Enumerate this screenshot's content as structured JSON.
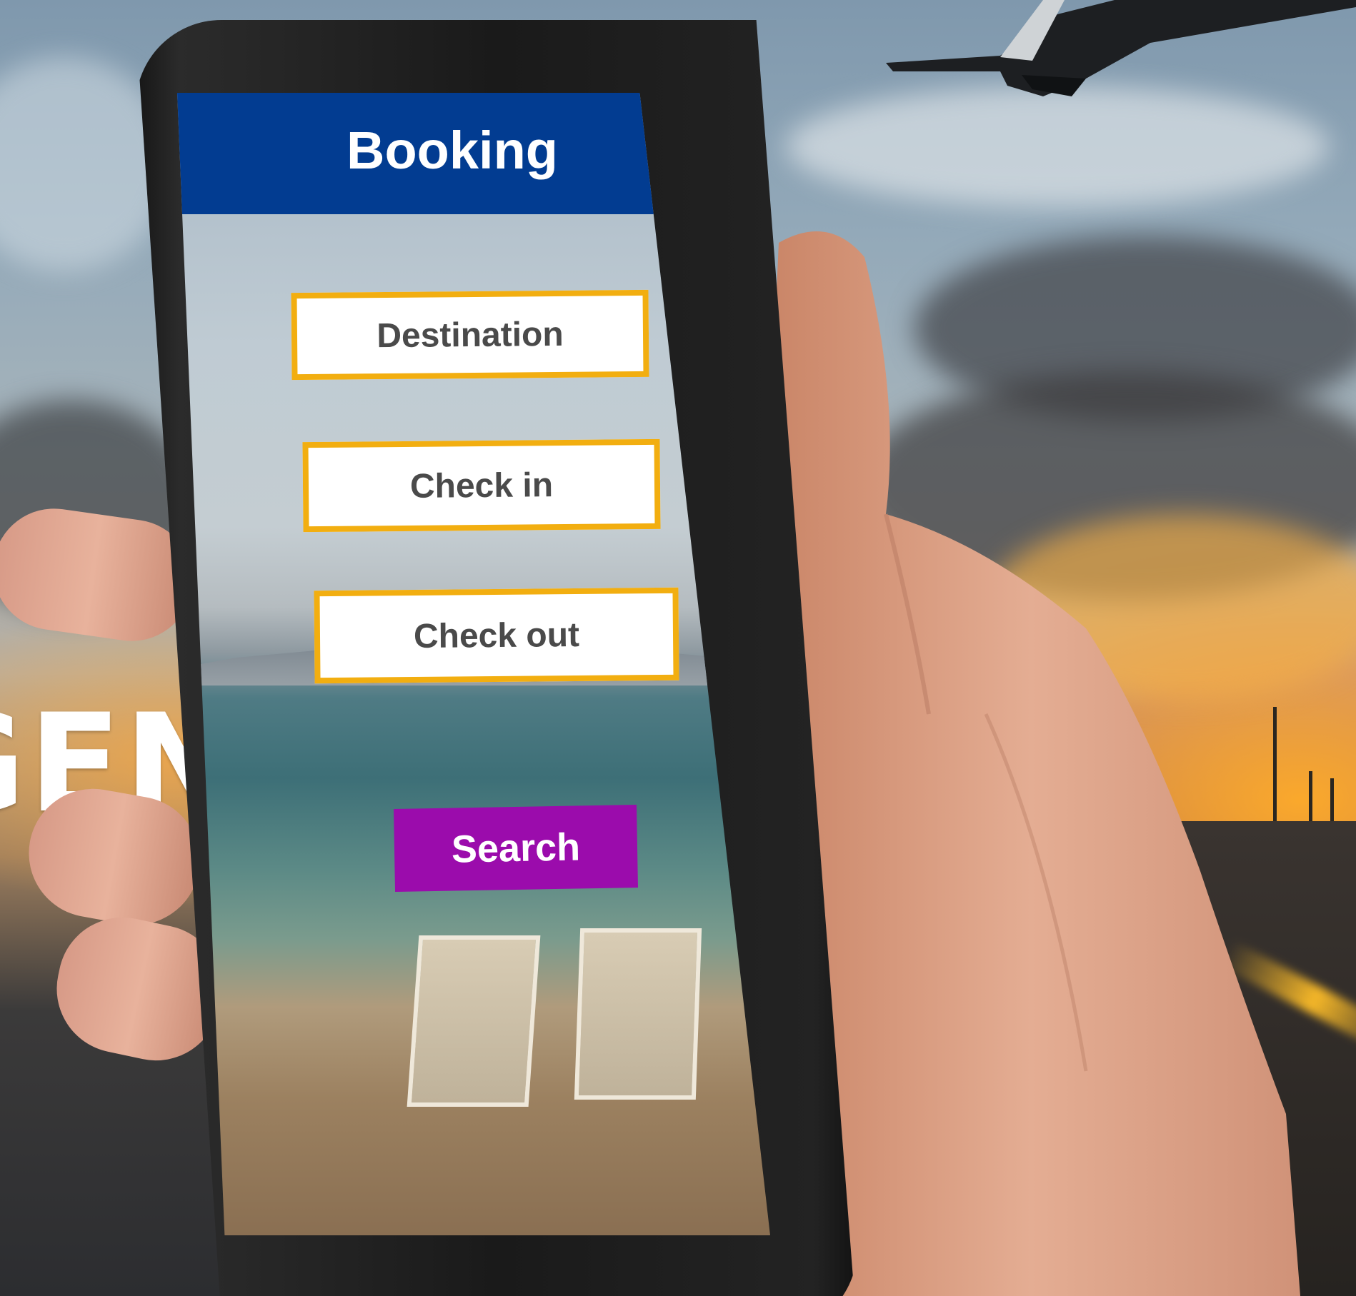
{
  "backdrop": {
    "headline": "GENTS"
  },
  "phone_app": {
    "header_title": "Booking",
    "fields": {
      "destination": "Destination",
      "check_in": "Check in",
      "check_out": "Check out"
    },
    "search_button": "Search",
    "colors": {
      "header": "#023c91",
      "field_border": "#f2ae10",
      "search_button": "#9b0cac"
    }
  }
}
